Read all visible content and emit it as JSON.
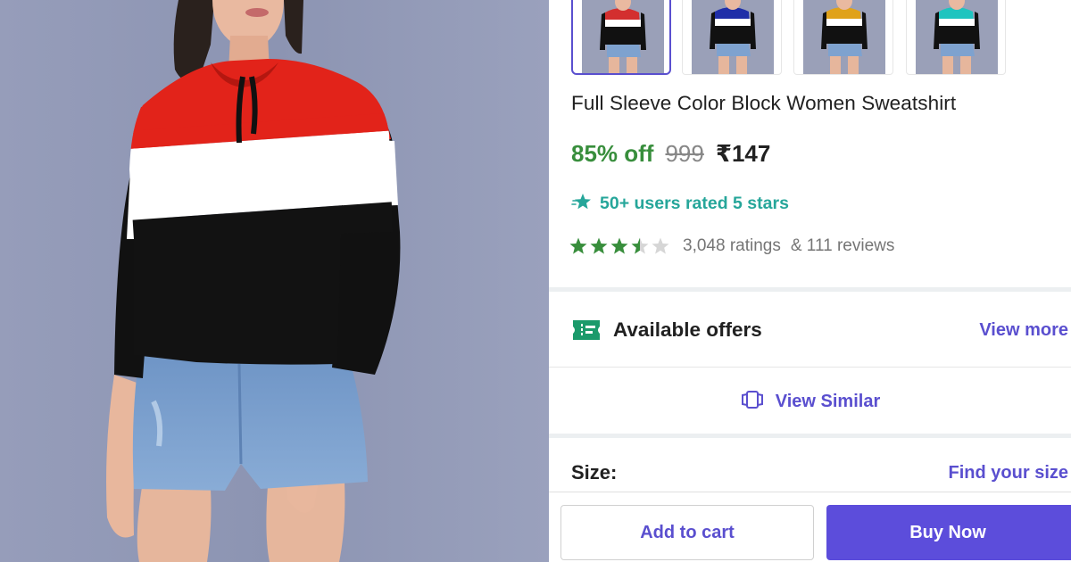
{
  "product": {
    "title": "Full Sleeve Color Block Women Sweatshirt",
    "discount": "85% off",
    "mrp": "999",
    "price": "₹147",
    "highlight": "50+ users rated 5 stars",
    "rating_value": 3.5,
    "rating_max": 5,
    "ratings_count": "3,048 ratings",
    "reviews_count": "& 111 reviews"
  },
  "thumbnails": [
    {
      "color": "#d32f2f",
      "selected": true
    },
    {
      "color": "#1f2ea8",
      "selected": false
    },
    {
      "color": "#e0a21a",
      "selected": false
    },
    {
      "color": "#1ec4bf",
      "selected": false
    }
  ],
  "offers": {
    "label": "Available offers",
    "link": "View more"
  },
  "similar": {
    "label": "View Similar"
  },
  "size": {
    "label": "Size:",
    "link": "Find your size"
  },
  "actions": {
    "add_to_cart": "Add to cart",
    "buy_now": "Buy Now"
  },
  "colors": {
    "accent": "#5a4fcf",
    "buy_button": "#5c4ddb",
    "discount_green": "#388e3c",
    "rating_green": "#388e3c",
    "highlight_teal": "#26a69a",
    "hero_background": "#8e96b4"
  },
  "icons": {
    "highlight": "sparkle-star-icon",
    "offers": "ticket-icon",
    "similar": "view-similar-icon"
  }
}
